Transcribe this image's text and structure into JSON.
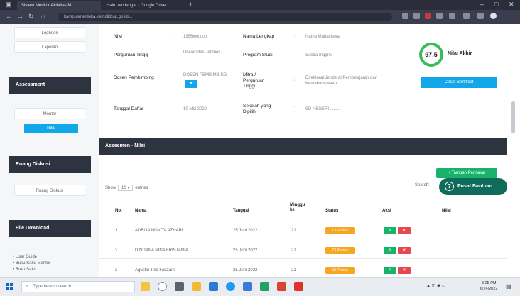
{
  "browser": {
    "tabs": [
      {
        "title": "Sistem Monitor Aktivitas M..."
      },
      {
        "title": "Halo pendengar - Google Drive"
      }
    ],
    "url": "kampusmerdeka.kemdikbud.go.id/..."
  },
  "sidebar": {
    "links_top": [
      "Logbook",
      "Laporan"
    ],
    "assessment_heading": "Assessment",
    "assessment_items": [
      "Mentor",
      "Nilai"
    ],
    "room_heading": "Ruang Diskusi",
    "room_item": "Ruang Diskusi",
    "download_heading": "File Download",
    "downloads": [
      "User Guide",
      "Buku Saku Mentor",
      "Buku Saku"
    ]
  },
  "profile": {
    "rows": [
      {
        "label": "NIM",
        "value": "1956xxxxxxx",
        "label2": "Nama Lengkap",
        "value2": "Nama Mahasiswa"
      },
      {
        "label": "Perguruan Tinggi",
        "value": "Universitas Jember",
        "label2": "Program Studi",
        "value2": "Sastra Inggris"
      },
      {
        "label": "Dosen Pembimbing",
        "value": "DOSEN PEMBIMBING",
        "label2": "Mitra / Perguruan Tinggi",
        "value2": "Direktorat Jenderal Pembelajaran dan Kemahasiswaan"
      },
      {
        "label": "Tanggal Daftar",
        "value": "10 Mei 2022",
        "label2": "Sekolah yang Dipilih",
        "value2": "SD NEGERI ........."
      }
    ],
    "select_label": "▾"
  },
  "score": {
    "value": "97,5",
    "label": "Nilai Akhir",
    "button": "Cetak Sertifikat"
  },
  "section_title": "Assesmen - Nilai",
  "add_button": "+ Tambah Penilaian",
  "help_button": "Pusat Bantuan",
  "table": {
    "show_prefix": "Show",
    "show_value": "10",
    "show_suffix": "entries",
    "search_label": "Search:",
    "headers": [
      "No.",
      "Nama",
      "Tanggal",
      "Minggu ke",
      "Status",
      "Aksi",
      "Nilai"
    ],
    "rows": [
      {
        "no": "1",
        "name": "ADELIA NOVITA AZHARI",
        "date": "25 Juni 2022",
        "week": "21",
        "status": "Di Proses"
      },
      {
        "no": "2",
        "name": "DINDANA NINA FRISTANIA",
        "date": "25 Juni 2022",
        "week": "21",
        "status": "Di Proses"
      },
      {
        "no": "3",
        "name": "Agustin Tika Fauzani",
        "date": "25 Juni 2022",
        "week": "21",
        "status": "Di Proses"
      }
    ],
    "action_edit": "✎",
    "action_delete": "✕"
  },
  "taskbar": {
    "search_placeholder": "Type here to search",
    "time": "3:25 PM",
    "date": "6/24/2022"
  }
}
